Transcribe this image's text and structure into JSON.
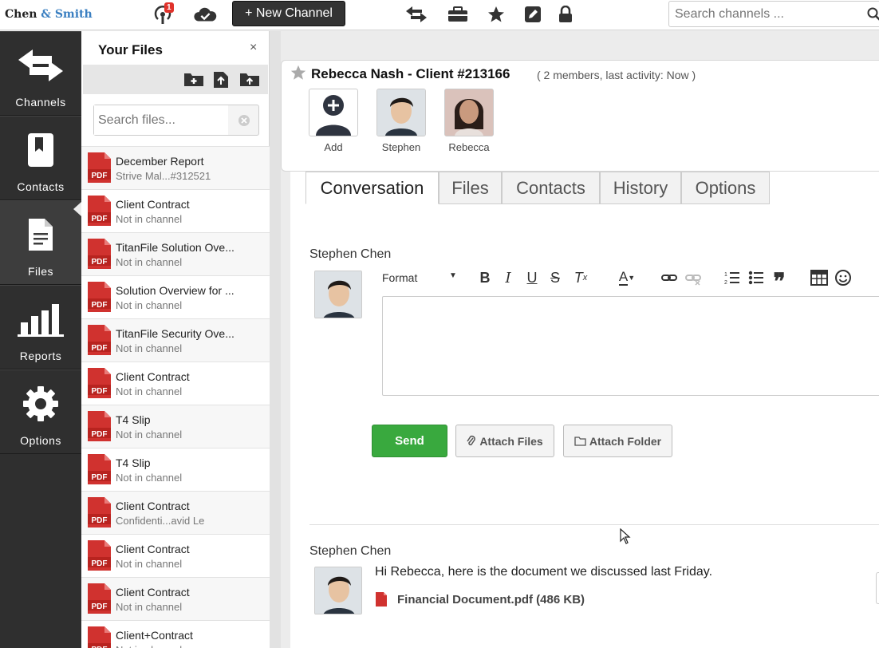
{
  "brand": {
    "part1": "Chen",
    "amp": "&",
    "part2": "Smith"
  },
  "topbar": {
    "notification_count": "1",
    "new_channel_label": "+ New Channel",
    "search_placeholder": "Search channels ..."
  },
  "nav": {
    "items": [
      {
        "label": "Channels"
      },
      {
        "label": "Contacts"
      },
      {
        "label": "Files"
      },
      {
        "label": "Reports"
      },
      {
        "label": "Options"
      }
    ]
  },
  "files_panel": {
    "title": "Your Files",
    "close": "×",
    "search_placeholder": "Search files...",
    "pdf_label": "PDF",
    "files": [
      {
        "name": "December Report",
        "sub": "Strive Mal...#312521"
      },
      {
        "name": "Client Contract",
        "sub": "Not in channel"
      },
      {
        "name": "TitanFile Solution Ove...",
        "sub": "Not in channel"
      },
      {
        "name": "Solution Overview for ...",
        "sub": "Not in channel"
      },
      {
        "name": "TitanFile Security Ove...",
        "sub": "Not in channel"
      },
      {
        "name": "Client Contract",
        "sub": "Not in channel"
      },
      {
        "name": "T4 Slip",
        "sub": "Not in channel"
      },
      {
        "name": "T4 Slip",
        "sub": "Not in channel"
      },
      {
        "name": "Client Contract",
        "sub": "Confidenti...avid Le"
      },
      {
        "name": "Client Contract",
        "sub": "Not in channel"
      },
      {
        "name": "Client Contract",
        "sub": "Not in channel"
      },
      {
        "name": "Client+Contract",
        "sub": "Not in channel"
      }
    ]
  },
  "channel": {
    "title": "Rebecca Nash - Client #213166",
    "meta": "( 2 members, last activity: Now )",
    "members": [
      {
        "name": "Add"
      },
      {
        "name": "Stephen"
      },
      {
        "name": "Rebecca"
      }
    ]
  },
  "tabs": [
    {
      "label": "Conversation"
    },
    {
      "label": "Files"
    },
    {
      "label": "Contacts"
    },
    {
      "label": "History"
    },
    {
      "label": "Options"
    }
  ],
  "composer": {
    "sender": "Stephen Chen",
    "format_label": "Format",
    "send_label": "Send",
    "attach_files_label": "Attach Files",
    "attach_folder_label": "Attach Folder"
  },
  "message": {
    "sender": "Stephen Chen",
    "text": "Hi Rebecca, here is the document we discussed last Friday.",
    "attachment": "Financial Document.pdf (486 KB)"
  },
  "colors": {
    "accent": "#3a7fc1",
    "send": "#39a93e",
    "pdf_red": "#d0322f",
    "badge": "#e0322b"
  }
}
